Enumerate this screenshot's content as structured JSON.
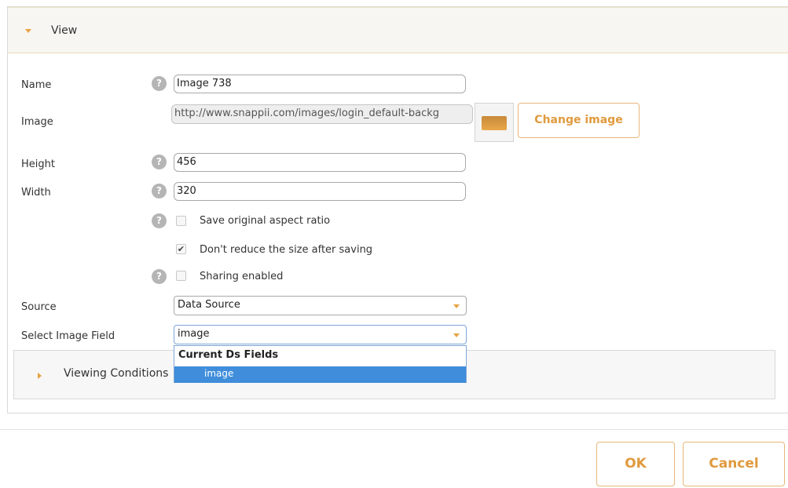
{
  "view_panel": {
    "title": "View"
  },
  "help_glyph": "?",
  "fields": {
    "name": {
      "label": "Name",
      "value": "Image 738"
    },
    "image": {
      "label": "Image",
      "value": "http://www.snappii.com/images/login_default-backg",
      "change_button": "Change image"
    },
    "height": {
      "label": "Height",
      "value": "456"
    },
    "width": {
      "label": "Width",
      "value": "320"
    },
    "source": {
      "label": "Source",
      "value": "Data Source"
    },
    "image_field": {
      "label": "Select Image Field",
      "value": "image"
    }
  },
  "checkboxes": {
    "aspect": {
      "label": "Save original aspect ratio",
      "checked": false
    },
    "reduce": {
      "label": "Don't reduce the size after saving",
      "checked": true,
      "mark": "✔"
    },
    "sharing": {
      "label": "Sharing enabled",
      "checked": false
    }
  },
  "dropdown": {
    "group_label": "Current Ds Fields",
    "options": [
      "image"
    ],
    "selected": "image"
  },
  "viewing_conditions": {
    "title": "Viewing Conditions"
  },
  "footer": {
    "ok_label": "OK",
    "cancel_label": "Cancel"
  },
  "colors": {
    "accent": "#e8a341",
    "button_text": "#e09a3e",
    "selection": "#3f8ddb"
  }
}
